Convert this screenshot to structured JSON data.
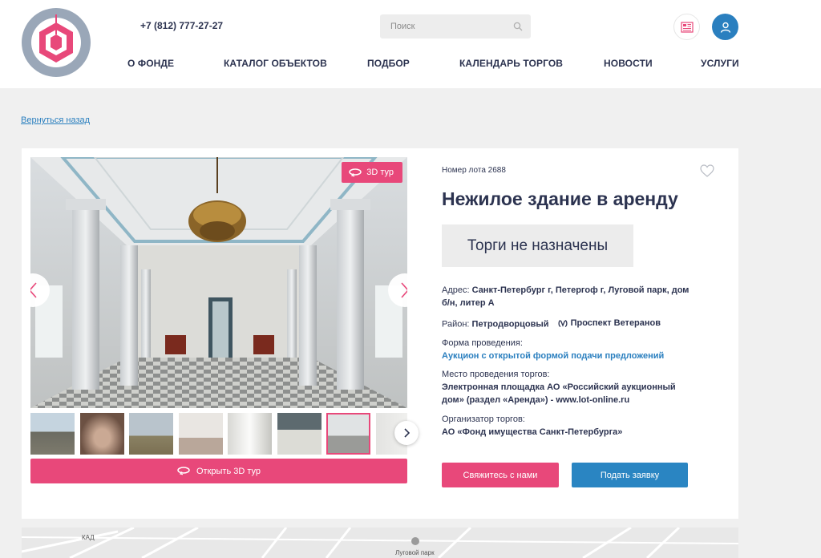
{
  "header": {
    "phone": "+7 (812) 777-27-27",
    "search_placeholder": "Поиск",
    "nav": [
      "О ФОНДЕ",
      "КАТАЛОГ ОБЪЕКТОВ",
      "ПОДБОР",
      "КАЛЕНДАРЬ ТОРГОВ",
      "НОВОСТИ",
      "УСЛУГИ"
    ],
    "accent": "#e8487a",
    "brand_blue": "#2a7fbf"
  },
  "back_link": "Вернуться назад",
  "gallery": {
    "tour_badge": "3D тур",
    "open_tour_label": "Открыть 3D тур",
    "thumb_count": 8,
    "active_thumb": 7
  },
  "lot": {
    "number": "Номер лота 2688",
    "title": "Нежилое здание в аренду",
    "status": "Торги не назначены",
    "address_label": "Адрес:",
    "address_value": "Санкт-Петербург г, Петергоф г, Луговой парк, дом б/н, литер А",
    "district_label": "Район:",
    "district_value": "Петродворцовый",
    "metro": "Проспект Ветеранов",
    "form_label": "Форма проведения:",
    "form_value": "Аукцион с открытой формой подачи предложений",
    "place_label": "Место проведения торгов:",
    "place_value": "Электронная площадка АО «Российский аукционный дом» (раздел «Аренда») - www.lot-online.ru",
    "org_label": "Организатор торгов:",
    "org_value": "АО «Фонд имущества Санкт-Петербурга»",
    "contact_button": "Свяжитесь с нами",
    "apply_button": "Подать заявку"
  },
  "map": {
    "labels": [
      "КАД",
      "Луговой парк"
    ]
  }
}
